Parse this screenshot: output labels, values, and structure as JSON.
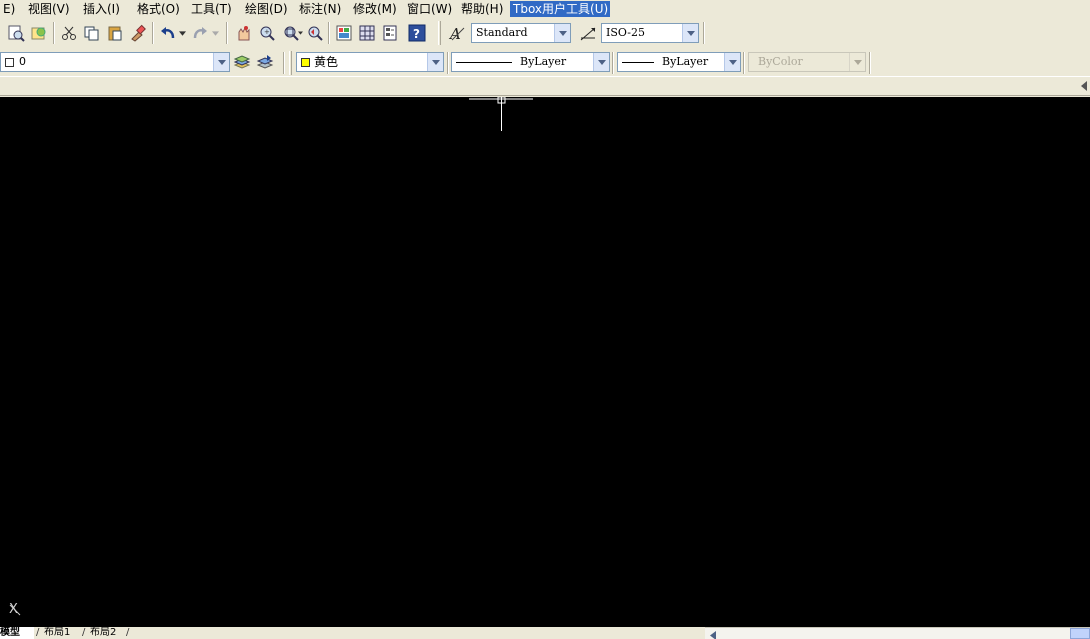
{
  "menubar": {
    "items": [
      {
        "label": "E)"
      },
      {
        "label": "视图(V)"
      },
      {
        "label": "插入(I)"
      },
      {
        "label": "格式(O)"
      },
      {
        "label": "工具(T)"
      },
      {
        "label": "绘图(D)"
      },
      {
        "label": "标注(N)"
      },
      {
        "label": "修改(M)"
      },
      {
        "label": "窗口(W)"
      },
      {
        "label": "帮助(H)"
      },
      {
        "label": "Tbox用户工具(U)"
      }
    ],
    "active_item": "Tbox用户工具(U)"
  },
  "standard_toolbar": {
    "text_style": "Standard",
    "dim_style": "ISO-25"
  },
  "properties_toolbar": {
    "layer": "0",
    "color": "黄色",
    "color_swatch": "#ffff00",
    "linetype": "ByLayer",
    "lineweight": "ByLayer",
    "plotstyle": "ByColor"
  },
  "icons": [
    "preview-icon",
    "publish-icon",
    "cut-icon",
    "copy-icon",
    "paste-icon",
    "matchprop-icon",
    "undo-icon",
    "redo-icon",
    "pan-icon",
    "zoom-realtime-icon",
    "zoom-window-icon",
    "zoom-previous-icon",
    "properties-icon",
    "designcenter-icon",
    "toolpalette-icon",
    "help-icon",
    "text-style-icon",
    "dim-style-icon",
    "layer-manager-icon",
    "layer-previous-icon",
    "collapse-arrow-icon"
  ],
  "canvas": {
    "background": "#000000",
    "ucs_axis_label": "X"
  },
  "layout_tabs": [
    {
      "label": "模型"
    },
    {
      "label": "布局1"
    },
    {
      "label": "布局2"
    }
  ]
}
